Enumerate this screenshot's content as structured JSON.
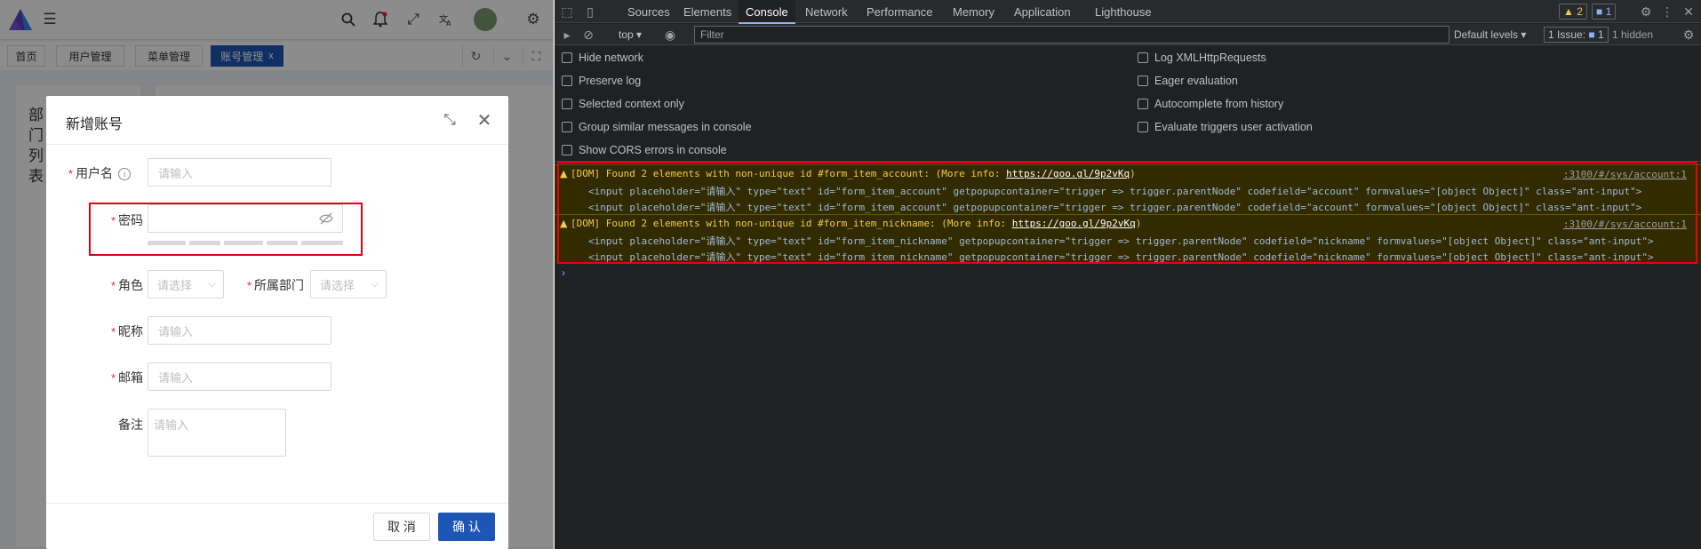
{
  "app": {
    "tabs": [
      {
        "label": "首页"
      },
      {
        "label": "用户管理"
      },
      {
        "label": "菜单管理"
      },
      {
        "label": "账号管理",
        "close": "x"
      }
    ],
    "dept_title": "部门列表",
    "modal": {
      "title": "新增账号",
      "fields": {
        "username": {
          "label": "用户名",
          "placeholder": "请输入"
        },
        "password": {
          "label": "密码"
        },
        "role": {
          "label": "角色",
          "placeholder": "请选择"
        },
        "department": {
          "label": "所属部门",
          "placeholder": "请选择"
        },
        "nickname": {
          "label": "昵称",
          "placeholder": "请输入"
        },
        "email": {
          "label": "邮箱",
          "placeholder": "请输入"
        },
        "remark": {
          "label": "备注",
          "placeholder": "请输入"
        }
      },
      "cancel_label": "取 消",
      "ok_label": "确 认"
    },
    "colors": {
      "primary": "#1e56b6",
      "highlight": "#e60012"
    }
  },
  "devtools": {
    "tabs": [
      "Sources",
      "Elements",
      "Console",
      "Network",
      "Performance",
      "Memory",
      "Application",
      "Lighthouse"
    ],
    "active_tab": "Console",
    "warnings_badge": "2",
    "messages_badge": "1",
    "context": "top",
    "filter_placeholder": "Filter",
    "default_levels": "Default levels",
    "issues_label": "1 Issue:",
    "issues_count": "1",
    "hidden_label": "1 hidden",
    "settings_left": [
      "Hide network",
      "Preserve log",
      "Selected context only",
      "Group similar messages in console",
      "Show CORS errors in console"
    ],
    "settings_right": [
      "Log XMLHttpRequests",
      "Eager evaluation",
      "Autocomplete from history",
      "Evaluate triggers user activation"
    ],
    "messages": [
      {
        "head": "[DOM] Found 2 elements with non-unique id #form_item_account: (More info: ",
        "link": "https://goo.gl/9p2vKq",
        "tail": ")",
        "source": ":3100/#/sys/account:1",
        "line1": "<input placeholder=\"请输入\" type=\"text\" id=\"form_item_account\" getpopupcontainer=\"trigger => trigger.parentNode\" codefield=\"account\" formvalues=\"[object Object]\" class=\"ant-input\">",
        "line2": "<input placeholder=\"请输入\" type=\"text\" id=\"form_item_account\" getpopupcontainer=\"trigger => trigger.parentNode\" codefield=\"account\" formvalues=\"[object Object]\" class=\"ant-input\">"
      },
      {
        "head": "[DOM] Found 2 elements with non-unique id #form_item_nickname: (More info: ",
        "link": "https://goo.gl/9p2vKq",
        "tail": ")",
        "source": ":3100/#/sys/account:1",
        "line1": "<input placeholder=\"请输入\" type=\"text\" id=\"form_item_nickname\" getpopupcontainer=\"trigger => trigger.parentNode\" codefield=\"nickname\" formvalues=\"[object Object]\" class=\"ant-input\">",
        "line2": "<input placeholder=\"请输入\" type=\"text\" id=\"form_item_nickname\" getpopupcontainer=\"trigger => trigger.parentNode\" codefield=\"nickname\" formvalues=\"[object Object]\" class=\"ant-input\">"
      }
    ],
    "prompt": "›",
    "colors": {
      "bg": "#202124",
      "warn_bg": "#332b00",
      "accent": "#8ab4f8"
    }
  }
}
